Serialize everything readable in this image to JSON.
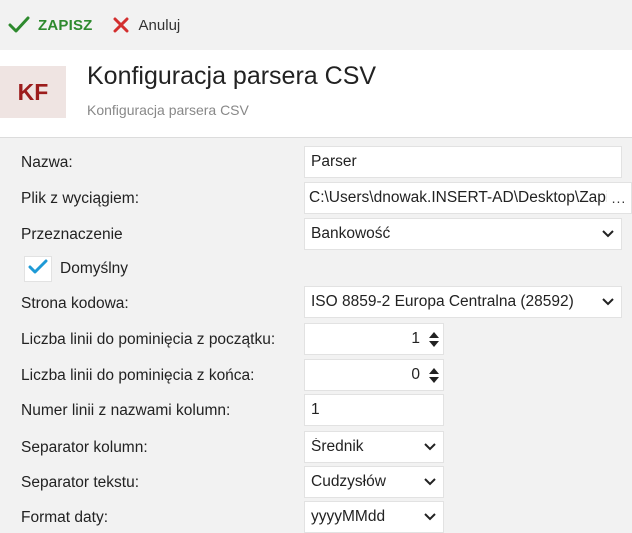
{
  "toolbar": {
    "save_label": "ZAPISZ",
    "cancel_label": "Anuluj",
    "save_icon": "checkmark-icon",
    "cancel_icon": "close-icon"
  },
  "header": {
    "avatar": "KF",
    "title": "Konfiguracja parsera CSV",
    "subtitle": "Konfiguracja parsera CSV"
  },
  "form": {
    "name": {
      "label": "Nazwa:",
      "value": "Parser"
    },
    "statement_file": {
      "label": "Plik z wyciągiem:",
      "value": "C:\\Users\\dnowak.INSERT-AD\\Desktop\\Zapisane pliki",
      "browse": "..."
    },
    "purpose": {
      "label": "Przeznaczenie",
      "value": "Bankowość"
    },
    "default": {
      "label": "Domyślny",
      "checked": true
    },
    "code_page": {
      "label": "Strona kodowa:",
      "value": "ISO 8859-2 Europa Centralna (28592)"
    },
    "skip_start": {
      "label": "Liczba linii do pominięcia z początku:",
      "value": "1"
    },
    "skip_end": {
      "label": "Liczba linii do pominięcia z końca:",
      "value": "0"
    },
    "header_line": {
      "label": "Numer linii z nazwami kolumn:",
      "value": "1"
    },
    "column_separator": {
      "label": "Separator kolumn:",
      "value": "Średnik"
    },
    "text_separator": {
      "label": "Separator tekstu:",
      "value": "Cudzysłów"
    },
    "date_format": {
      "label": "Format daty:",
      "value": "yyyyMMdd"
    }
  },
  "colors": {
    "accent_green": "#2e8a2e",
    "cancel_red": "#d32f2f",
    "avatar_red": "#9c1c1c",
    "checkbox_blue": "#1e9ad6"
  }
}
